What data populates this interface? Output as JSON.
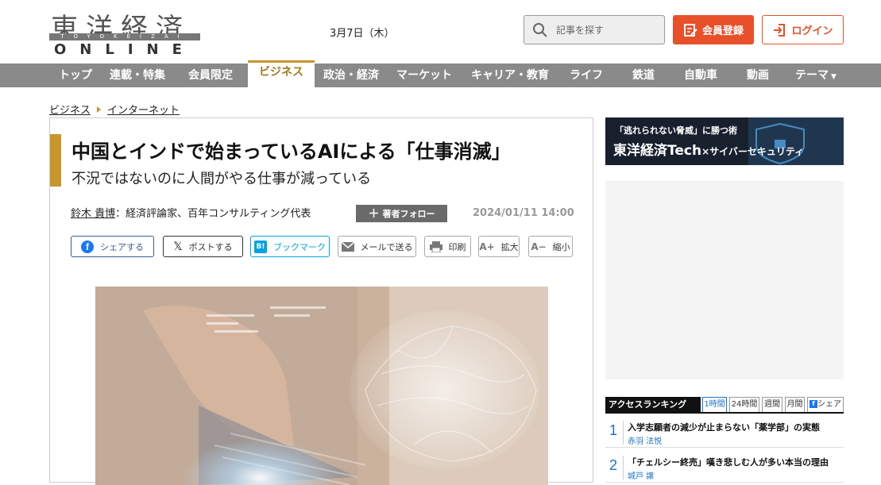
{
  "header": {
    "logo_jp": "東洋経済",
    "logo_band": "TOYOKEIZAI",
    "logo_en": "ONLINE",
    "date": "3月7日（木）",
    "search_placeholder": "記事を探す",
    "register_label": "会員登録",
    "login_label": "ログイン",
    "accent_color": "#e8502a"
  },
  "nav": {
    "items": [
      "トップ",
      "連載・特集",
      "会員限定",
      "ビジネス",
      "政治・経済",
      "マーケット",
      "キャリア・教育",
      "ライフ",
      "鉄道",
      "自動車",
      "動画",
      "テーマ"
    ],
    "active": "ビジネス"
  },
  "breadcrumb": [
    "ビジネス",
    "インターネット"
  ],
  "article": {
    "title": "中国とインドで始まっているAIによる「仕事消滅」",
    "subtitle": "不況ではないのに人間がやる仕事が減っている",
    "author": "鈴木 貴博",
    "author_role": "：経済評論家、百年コンサルティング代表",
    "follow_label": "著者フォロー",
    "published": "2024/01/11 14:00",
    "share": {
      "facebook": "シェアする",
      "x": "ポストする",
      "hatena": "ブックマーク",
      "mail": "メールで送る",
      "print": "印刷",
      "zoom_in": "拡大",
      "zoom_out": "縮小"
    }
  },
  "sidebar": {
    "banner_small": "「逃れられない脅威」に勝つ術",
    "banner_main": "東洋経済Tech",
    "banner_sub": "×サイバーセキュリティ",
    "ranking": {
      "title": "アクセスランキング",
      "tabs": [
        "1時間",
        "24時間",
        "週間",
        "月間",
        "シェア"
      ],
      "items": [
        {
          "rank": "1",
          "title": "入学志願者の減少が止まらない「薬学部」の実態",
          "author": "赤羽 法悦"
        },
        {
          "rank": "2",
          "title": "「チェルシー終売」嘆き悲しむ人が多い本当の理由",
          "author": "城戸 譲"
        }
      ]
    }
  }
}
